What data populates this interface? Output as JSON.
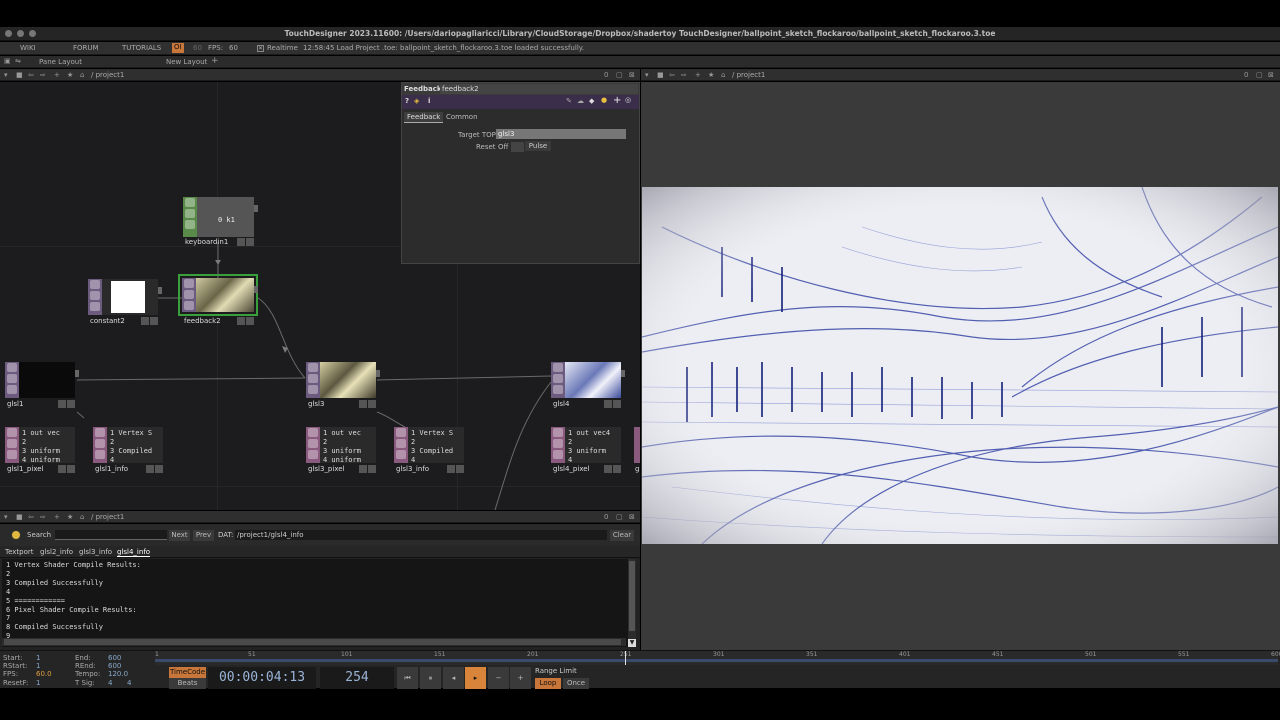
{
  "app": {
    "title": "TouchDesigner 2023.11600: /Users/dariopagliaricci/Library/CloudStorage/Dropbox/shadertoy TouchDesigner/ballpoint_sketch_flockaroo/ballpoint_sketch_flockaroo.3.toe"
  },
  "menu": {
    "wiki": "WIKI",
    "forum": "FORUM",
    "tutorials": "TUTORIALS",
    "oi": "OI",
    "sixty": "60",
    "fps_label": "FPS:",
    "fps_value": "60",
    "realtime": "Realtime",
    "status": "12:58:45 Load Project .toe: ballpoint_sketch_flockaroo.3.toe loaded successfully."
  },
  "layout_bar": {
    "pane_layout": "Pane Layout",
    "new_layout": "New Layout"
  },
  "network_pane": {
    "path": "/ project1",
    "zero": "0"
  },
  "viewer_pane": {
    "path": "/ project1",
    "zero": "0"
  },
  "textport_pane": {
    "path": "/ project1",
    "zero": "0"
  },
  "nodes": {
    "keyboardin1": {
      "name": "keyboardin1",
      "value": "0 k1"
    },
    "constant2": {
      "name": "constant2"
    },
    "feedback2": {
      "name": "feedback2"
    },
    "glsl1": {
      "name": "glsl1"
    },
    "glsl3": {
      "name": "glsl3"
    },
    "glsl4": {
      "name": "glsl4"
    },
    "glsl1_pixel": {
      "name": "glsl1_pixel",
      "text": "1 out vec\n2\n3 uniform\n4 uniform"
    },
    "glsl1_info": {
      "name": "glsl1_info",
      "text": "1 Vertex S\n2\n3 Compiled\n4"
    },
    "glsl3_pixel": {
      "name": "glsl3_pixel",
      "text": "1 out vec\n2\n3 uniform\n4 uniform"
    },
    "glsl3_info": {
      "name": "glsl3_info",
      "text": "1 Vertex S\n2\n3 Compiled\n4"
    },
    "glsl4_pixel": {
      "name": "glsl4_pixel",
      "text": "1 out vec4\n2\n3 uniform\n4"
    },
    "partial": {
      "name": "g"
    }
  },
  "params": {
    "op_type": "Feedback",
    "op_name": "feedback2",
    "tabs": [
      "Feedback",
      "Common"
    ],
    "target_top_label": "Target TOP",
    "target_top_value": "glsl3",
    "reset_label": "Reset",
    "reset_value": "Off",
    "pulse_label": "Pulse"
  },
  "textport": {
    "search_label": "Search",
    "next": "Next",
    "prev": "Prev",
    "dat_label": "DAT:",
    "dat_path": "/project1/glsl4_info",
    "clear": "Clear",
    "tabs": [
      "Textport",
      "glsl2_info",
      "glsl3_info",
      "glsl4_info"
    ],
    "lines": [
      "1 Vertex Shader Compile Results:",
      "2",
      "3 Compiled Successfully",
      "4",
      "5 ============",
      "6 Pixel Shader Compile Results:",
      "7",
      "8 Compiled Successfully",
      "9"
    ]
  },
  "timeline": {
    "start_label": "Start:",
    "start": "1",
    "end_label": "End:",
    "end": "600",
    "rstart_label": "RStart:",
    "rstart": "1",
    "rend_label": "REnd:",
    "rend": "600",
    "fps_label": "FPS:",
    "fps": "60.0",
    "tempo_label": "Tempo:",
    "tempo": "120.0",
    "resetf_label": "ResetF:",
    "resetf": "1",
    "tsig_label": "T Sig:",
    "tsig_a": "4",
    "tsig_b": "4",
    "timecode": "TimeCode",
    "beats": "Beats",
    "time": "00:00:04:13",
    "frame": "254",
    "range_limit": "Range Limit",
    "loop": "Loop",
    "once": "Once",
    "ruler": [
      "1",
      "51",
      "101",
      "151",
      "201",
      "251",
      "301",
      "351",
      "401",
      "451",
      "501",
      "551",
      "600"
    ],
    "current_fraction": 0.4215
  }
}
